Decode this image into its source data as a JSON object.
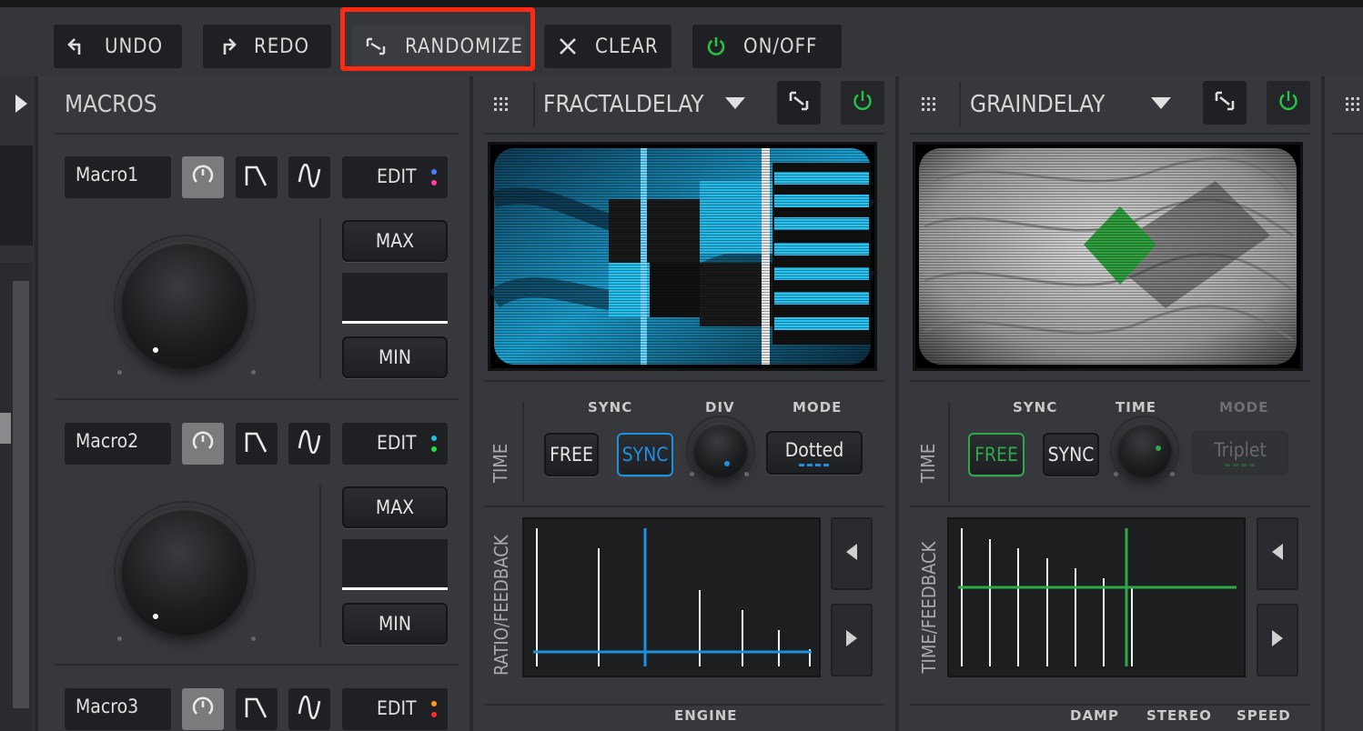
{
  "toolbar": {
    "undo_label": "UNDO",
    "redo_label": "REDO",
    "randomize_label": "RANDOMIZE",
    "clear_label": "CLEAR",
    "onoff_label": "ON/OFF"
  },
  "macros": {
    "title": "MACROS",
    "edit_label": "EDIT",
    "max_label": "MAX",
    "min_label": "MIN",
    "items": [
      {
        "name": "Macro1",
        "dot_colors": [
          "#4a7cff",
          "#ff3fa0"
        ],
        "level": 0.0
      },
      {
        "name": "Macro2",
        "dot_colors": [
          "#20c0d8",
          "#22dd44"
        ],
        "level": 0.0
      },
      {
        "name": "Macro3",
        "dot_colors": [
          "#ff9a1a",
          "#ff2a2a"
        ],
        "level": 0.0
      }
    ]
  },
  "fractal": {
    "title": "FRACTALDELAY",
    "sync_label": "SYNC",
    "div_label": "DIV",
    "mode_label": "MODE",
    "time_label": "TIME",
    "free_button": "FREE",
    "sync_button": "SYNC",
    "mode_value": "Dotted",
    "graph_label": "RATIO/FEEDBACK",
    "engine_label": "ENGINE",
    "accent": "#1e90e0"
  },
  "grain": {
    "title": "GRAINDELAY",
    "sync_label": "SYNC",
    "time_knob_label": "TIME",
    "mode_label": "MODE",
    "time_label": "TIME",
    "free_button": "FREE",
    "sync_button": "SYNC",
    "mode_value": "Triplet",
    "graph_label": "TIME/FEEDBACK",
    "damp_label": "DAMP",
    "stereo_label": "STEREO",
    "speed_label": "SPEED",
    "accent": "#2fa84a"
  },
  "icons": {
    "undo": "undo-icon",
    "redo": "redo-icon",
    "randomize": "randomize-icon",
    "clear": "close-icon",
    "power": "power-icon",
    "grid": "grid-icon",
    "dropdown": "triangle-down-icon",
    "collapse": "triangle-right-icon"
  }
}
